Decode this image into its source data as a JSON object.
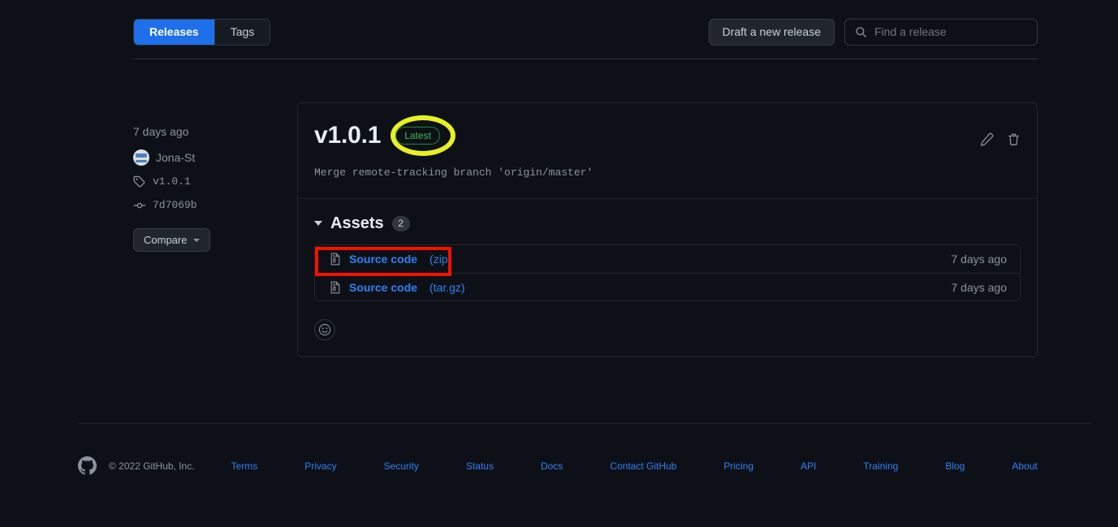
{
  "tabs": {
    "releases_label": "Releases",
    "tags_label": "Tags",
    "active": "Releases"
  },
  "toolbar": {
    "draft_label": "Draft a new release",
    "search_placeholder": "Find a release",
    "search_value": "",
    "search_icon": "search-icon"
  },
  "release_meta": {
    "published": "7 days ago",
    "author": "Jona-St",
    "tag": "v1.0.1",
    "commit": "7d7069b",
    "compare_label": "Compare"
  },
  "release": {
    "title": "v1.0.1",
    "badge": "Latest",
    "commit_message": "Merge remote-tracking branch 'origin/master'",
    "edit_icon": "pencil-icon",
    "delete_icon": "trash-icon"
  },
  "assets": {
    "heading": "Assets",
    "count": "2",
    "rows": [
      {
        "name": "Source code",
        "ext": "(zip)",
        "time": "7 days ago",
        "icon": "file-zip-icon"
      },
      {
        "name": "Source code",
        "ext": "(tar.gz)",
        "time": "7 days ago",
        "icon": "file-zip-icon"
      }
    ],
    "reaction_icon": "smiley-icon"
  },
  "footer": {
    "logo_icon": "github-mark-icon",
    "copyright": "© 2022 GitHub, Inc.",
    "links": [
      "Terms",
      "Privacy",
      "Security",
      "Status",
      "Docs",
      "Contact GitHub",
      "Pricing",
      "API",
      "Training",
      "Blog",
      "About"
    ]
  },
  "annotations": {
    "ellipse_color": "#e8f024",
    "rect_color": "#f51000"
  },
  "colors": {
    "background": "#0d1117",
    "accent_blue": "#1f6feb",
    "link_blue": "#2f81f7",
    "green": "#3fb950",
    "muted": "#8b949e",
    "border": "#30363d"
  }
}
